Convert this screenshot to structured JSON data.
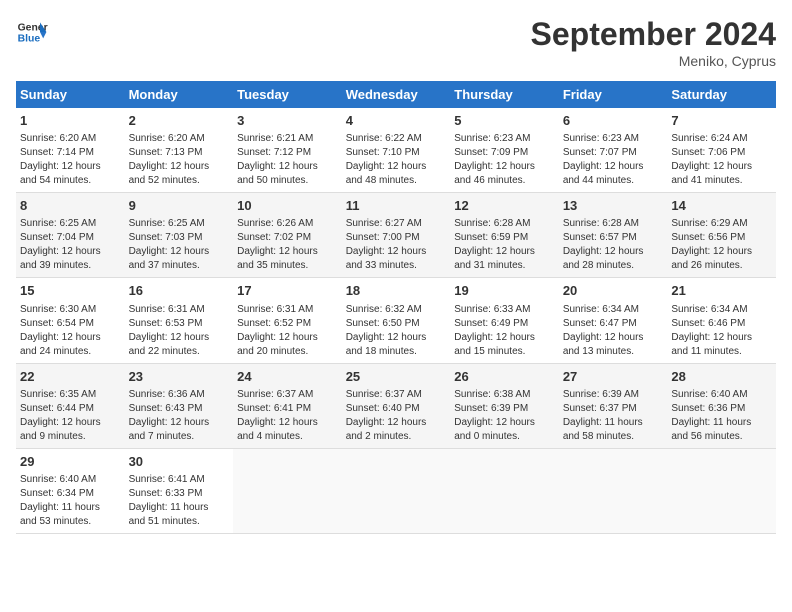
{
  "header": {
    "logo_text_general": "General",
    "logo_text_blue": "Blue",
    "month_title": "September 2024",
    "location": "Meniko, Cyprus"
  },
  "days_of_week": [
    "Sunday",
    "Monday",
    "Tuesday",
    "Wednesday",
    "Thursday",
    "Friday",
    "Saturday"
  ],
  "weeks": [
    [
      {
        "day": "1",
        "info": "Sunrise: 6:20 AM\nSunset: 7:14 PM\nDaylight: 12 hours\nand 54 minutes."
      },
      {
        "day": "2",
        "info": "Sunrise: 6:20 AM\nSunset: 7:13 PM\nDaylight: 12 hours\nand 52 minutes."
      },
      {
        "day": "3",
        "info": "Sunrise: 6:21 AM\nSunset: 7:12 PM\nDaylight: 12 hours\nand 50 minutes."
      },
      {
        "day": "4",
        "info": "Sunrise: 6:22 AM\nSunset: 7:10 PM\nDaylight: 12 hours\nand 48 minutes."
      },
      {
        "day": "5",
        "info": "Sunrise: 6:23 AM\nSunset: 7:09 PM\nDaylight: 12 hours\nand 46 minutes."
      },
      {
        "day": "6",
        "info": "Sunrise: 6:23 AM\nSunset: 7:07 PM\nDaylight: 12 hours\nand 44 minutes."
      },
      {
        "day": "7",
        "info": "Sunrise: 6:24 AM\nSunset: 7:06 PM\nDaylight: 12 hours\nand 41 minutes."
      }
    ],
    [
      {
        "day": "8",
        "info": "Sunrise: 6:25 AM\nSunset: 7:04 PM\nDaylight: 12 hours\nand 39 minutes."
      },
      {
        "day": "9",
        "info": "Sunrise: 6:25 AM\nSunset: 7:03 PM\nDaylight: 12 hours\nand 37 minutes."
      },
      {
        "day": "10",
        "info": "Sunrise: 6:26 AM\nSunset: 7:02 PM\nDaylight: 12 hours\nand 35 minutes."
      },
      {
        "day": "11",
        "info": "Sunrise: 6:27 AM\nSunset: 7:00 PM\nDaylight: 12 hours\nand 33 minutes."
      },
      {
        "day": "12",
        "info": "Sunrise: 6:28 AM\nSunset: 6:59 PM\nDaylight: 12 hours\nand 31 minutes."
      },
      {
        "day": "13",
        "info": "Sunrise: 6:28 AM\nSunset: 6:57 PM\nDaylight: 12 hours\nand 28 minutes."
      },
      {
        "day": "14",
        "info": "Sunrise: 6:29 AM\nSunset: 6:56 PM\nDaylight: 12 hours\nand 26 minutes."
      }
    ],
    [
      {
        "day": "15",
        "info": "Sunrise: 6:30 AM\nSunset: 6:54 PM\nDaylight: 12 hours\nand 24 minutes."
      },
      {
        "day": "16",
        "info": "Sunrise: 6:31 AM\nSunset: 6:53 PM\nDaylight: 12 hours\nand 22 minutes."
      },
      {
        "day": "17",
        "info": "Sunrise: 6:31 AM\nSunset: 6:52 PM\nDaylight: 12 hours\nand 20 minutes."
      },
      {
        "day": "18",
        "info": "Sunrise: 6:32 AM\nSunset: 6:50 PM\nDaylight: 12 hours\nand 18 minutes."
      },
      {
        "day": "19",
        "info": "Sunrise: 6:33 AM\nSunset: 6:49 PM\nDaylight: 12 hours\nand 15 minutes."
      },
      {
        "day": "20",
        "info": "Sunrise: 6:34 AM\nSunset: 6:47 PM\nDaylight: 12 hours\nand 13 minutes."
      },
      {
        "day": "21",
        "info": "Sunrise: 6:34 AM\nSunset: 6:46 PM\nDaylight: 12 hours\nand 11 minutes."
      }
    ],
    [
      {
        "day": "22",
        "info": "Sunrise: 6:35 AM\nSunset: 6:44 PM\nDaylight: 12 hours\nand 9 minutes."
      },
      {
        "day": "23",
        "info": "Sunrise: 6:36 AM\nSunset: 6:43 PM\nDaylight: 12 hours\nand 7 minutes."
      },
      {
        "day": "24",
        "info": "Sunrise: 6:37 AM\nSunset: 6:41 PM\nDaylight: 12 hours\nand 4 minutes."
      },
      {
        "day": "25",
        "info": "Sunrise: 6:37 AM\nSunset: 6:40 PM\nDaylight: 12 hours\nand 2 minutes."
      },
      {
        "day": "26",
        "info": "Sunrise: 6:38 AM\nSunset: 6:39 PM\nDaylight: 12 hours\nand 0 minutes."
      },
      {
        "day": "27",
        "info": "Sunrise: 6:39 AM\nSunset: 6:37 PM\nDaylight: 11 hours\nand 58 minutes."
      },
      {
        "day": "28",
        "info": "Sunrise: 6:40 AM\nSunset: 6:36 PM\nDaylight: 11 hours\nand 56 minutes."
      }
    ],
    [
      {
        "day": "29",
        "info": "Sunrise: 6:40 AM\nSunset: 6:34 PM\nDaylight: 11 hours\nand 53 minutes."
      },
      {
        "day": "30",
        "info": "Sunrise: 6:41 AM\nSunset: 6:33 PM\nDaylight: 11 hours\nand 51 minutes."
      },
      {
        "day": "",
        "info": ""
      },
      {
        "day": "",
        "info": ""
      },
      {
        "day": "",
        "info": ""
      },
      {
        "day": "",
        "info": ""
      },
      {
        "day": "",
        "info": ""
      }
    ]
  ]
}
